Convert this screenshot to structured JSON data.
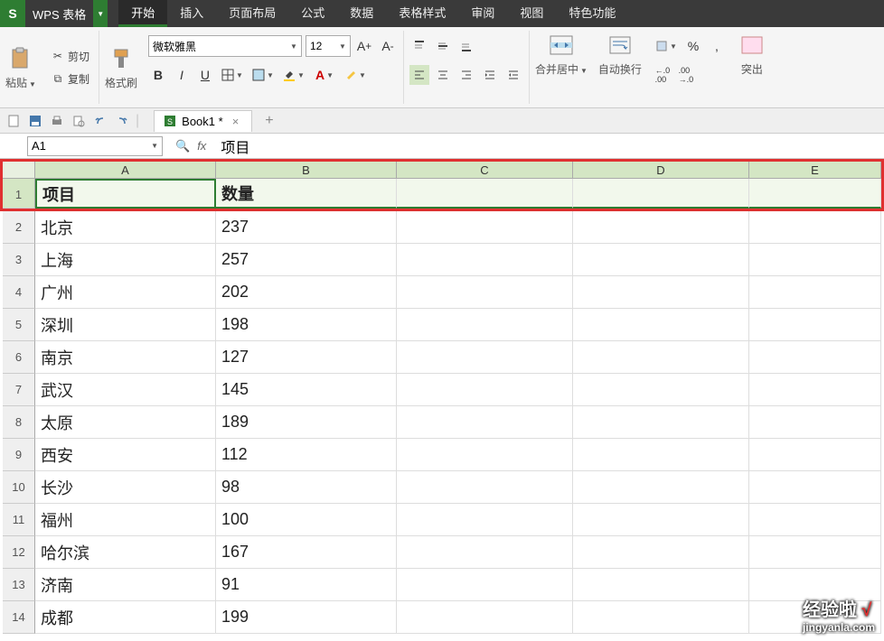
{
  "app": {
    "badge": "S",
    "name": "WPS 表格"
  },
  "menu": {
    "items": [
      "开始",
      "插入",
      "页面布局",
      "公式",
      "数据",
      "表格样式",
      "审阅",
      "视图",
      "特色功能"
    ],
    "active_index": 0
  },
  "ribbon": {
    "paste": "粘贴",
    "cut": "剪切",
    "copy": "复制",
    "format_painter": "格式刷",
    "font_name": "微软雅黑",
    "font_size": "12",
    "merge_center": "合并居中",
    "wrap_text": "自动换行",
    "percent": "%",
    "number_inc": ".00",
    "number_dec": ".00",
    "overflow": "突出"
  },
  "qat": {
    "file_tab": "Book1 *"
  },
  "formula_bar": {
    "cell_ref": "A1",
    "fx": "fx",
    "value": "项目"
  },
  "grid": {
    "columns": [
      "A",
      "B",
      "C",
      "D",
      "E"
    ],
    "rows": [
      {
        "n": 1,
        "a": "项目",
        "b": "数量"
      },
      {
        "n": 2,
        "a": "北京",
        "b": "237"
      },
      {
        "n": 3,
        "a": "上海",
        "b": "257"
      },
      {
        "n": 4,
        "a": "广州",
        "b": "202"
      },
      {
        "n": 5,
        "a": "深圳",
        "b": "198"
      },
      {
        "n": 6,
        "a": "南京",
        "b": "127"
      },
      {
        "n": 7,
        "a": "武汉",
        "b": "145"
      },
      {
        "n": 8,
        "a": "太原",
        "b": "189"
      },
      {
        "n": 9,
        "a": "西安",
        "b": "112"
      },
      {
        "n": 10,
        "a": "长沙",
        "b": "98"
      },
      {
        "n": 11,
        "a": "福州",
        "b": "100"
      },
      {
        "n": 12,
        "a": "哈尔滨",
        "b": "167"
      },
      {
        "n": 13,
        "a": "济南",
        "b": "91"
      },
      {
        "n": 14,
        "a": "成都",
        "b": "199"
      }
    ]
  },
  "watermark": {
    "brand": "经验啦",
    "mark": "√",
    "url": "jingyanla.com"
  }
}
